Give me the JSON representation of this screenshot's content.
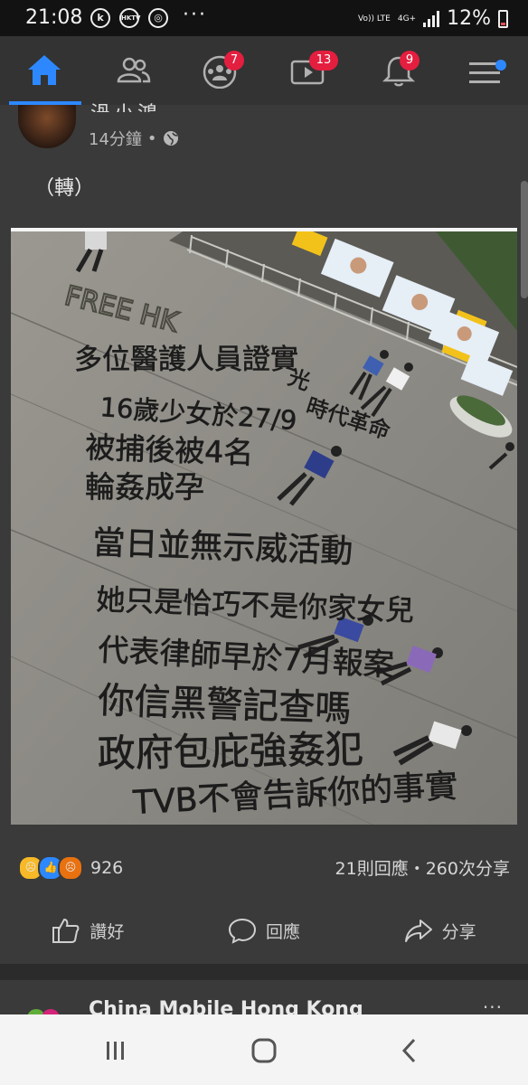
{
  "status_bar": {
    "time": "21:08",
    "icons": [
      "k-app-icon",
      "hktv-icon",
      "chat-icon"
    ],
    "more": "···",
    "network_top": "Vo)) LTE",
    "network_bottom": "4G+",
    "battery_percent": "12%"
  },
  "nav": {
    "items": [
      {
        "name": "home",
        "badge": ""
      },
      {
        "name": "friends",
        "badge": ""
      },
      {
        "name": "groups",
        "badge": "7"
      },
      {
        "name": "watch",
        "badge": "13"
      },
      {
        "name": "notifications",
        "badge": "9"
      },
      {
        "name": "menu",
        "badge": ""
      }
    ],
    "accent_color": "#2d88ff",
    "badge_color": "#e41e3f"
  },
  "post": {
    "author": "渦小鴻",
    "time": "14分鐘",
    "privacy_icon": "globe-icon",
    "text": "（轉）",
    "photo": {
      "graffiti_lines": [
        "FREE HK",
        "多位醫護人員證實",
        "16歲少女於27/9",
        "被捕後被4名",
        "輪姦成孕",
        "當日並無示威活動",
        "她只是恰巧不是你家女兒",
        "代表律師早於7月報案",
        "你信黑警記查嗎",
        "政府包庇強姦犯",
        "TVB不會告訴你的事實"
      ],
      "side_graffiti": [
        "光",
        "時代革命"
      ]
    },
    "reaction_count": "926",
    "comments_shares": "21則回應・260次分享",
    "actions": {
      "like": "讚好",
      "comment": "回應",
      "share": "分享"
    }
  },
  "next_post": {
    "author": "China Mobile Hong Kong",
    "more": "···"
  }
}
